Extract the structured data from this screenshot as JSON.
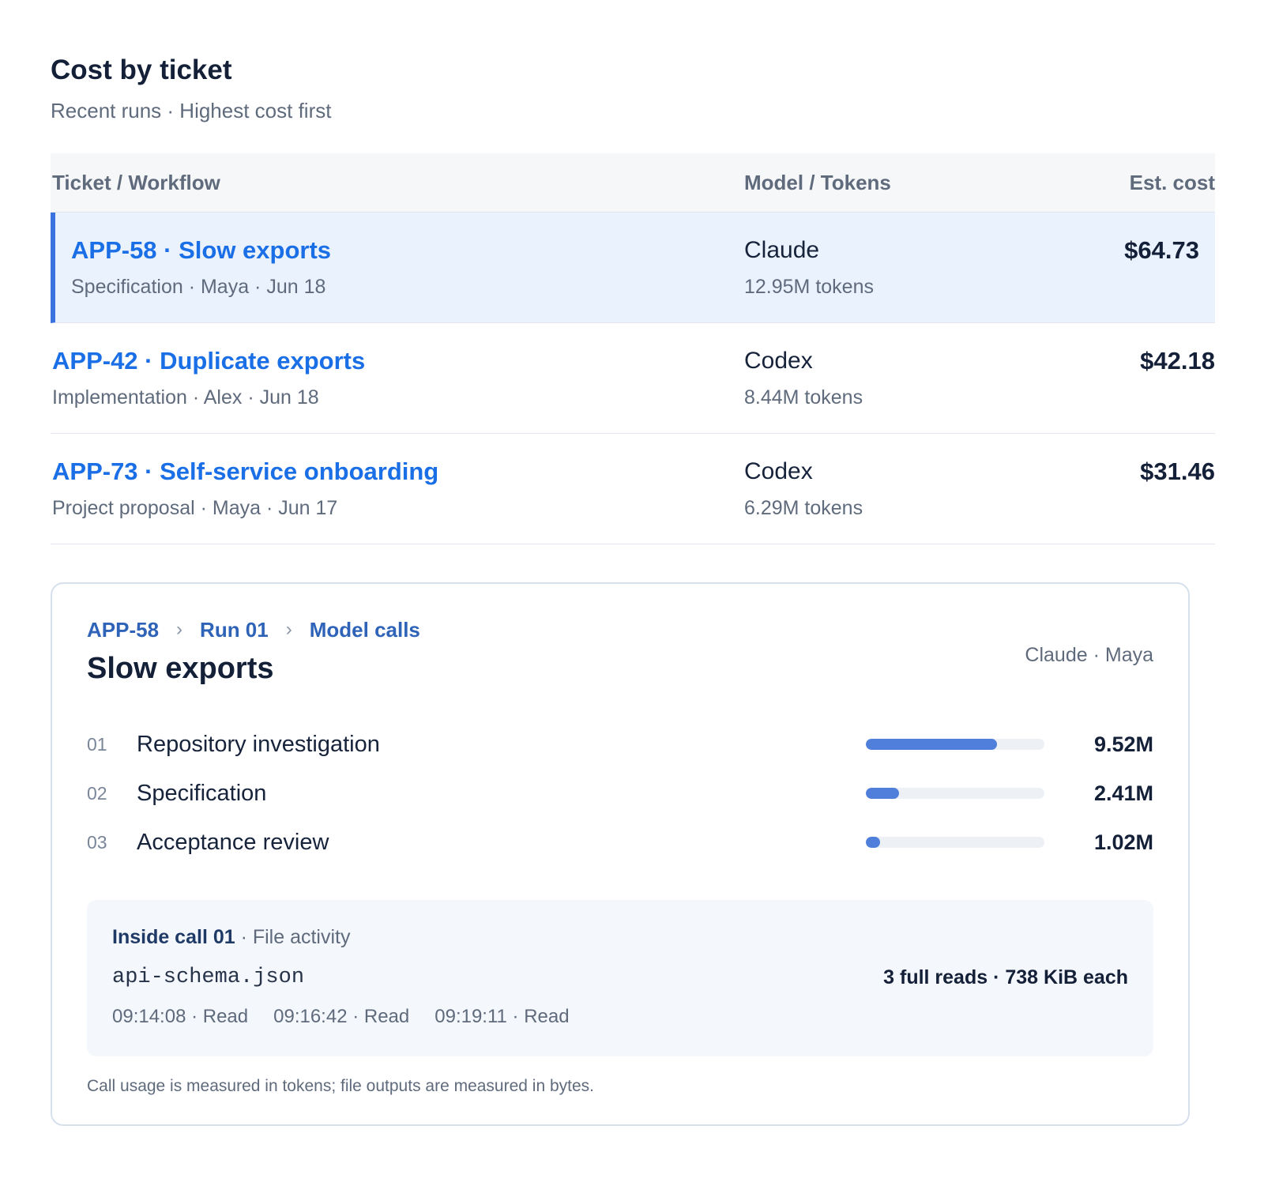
{
  "header": {
    "title": "Cost by ticket",
    "subtitle": "Recent runs · Highest cost first"
  },
  "table": {
    "columns": [
      "Ticket / Workflow",
      "Model / Tokens",
      "Est. cost"
    ],
    "rows": [
      {
        "ticket": "APP-58 · Slow exports",
        "meta": "Specification · Maya · Jun 18",
        "model": "Claude",
        "tokens": "12.95M tokens",
        "cost": "$64.73",
        "selected": true
      },
      {
        "ticket": "APP-42 · Duplicate exports",
        "meta": "Implementation · Alex · Jun 18",
        "model": "Codex",
        "tokens": "8.44M tokens",
        "cost": "$42.18",
        "selected": false
      },
      {
        "ticket": "APP-73 · Self-service onboarding",
        "meta": "Project proposal · Maya · Jun 17",
        "model": "Codex",
        "tokens": "6.29M tokens",
        "cost": "$31.46",
        "selected": false
      }
    ]
  },
  "detail": {
    "breadcrumb": [
      "APP-58",
      "Run 01",
      "Model calls"
    ],
    "breadcrumb_separator": "›",
    "title": "Slow exports",
    "meta": "Claude · Maya",
    "steps": [
      {
        "num": "01",
        "name": "Repository investigation",
        "value": "9.52M",
        "fraction": 0.735
      },
      {
        "num": "02",
        "name": "Specification",
        "value": "2.41M",
        "fraction": 0.186
      },
      {
        "num": "03",
        "name": "Acceptance review",
        "value": "1.02M",
        "fraction": 0.079
      }
    ],
    "file_activity": {
      "heading_strong": "Inside call 01",
      "heading_light": " · File activity",
      "file_name": "api-schema.json",
      "summary": "3 full reads · 738 KiB each",
      "reads": [
        "09:14:08 · Read",
        "09:16:42 · Read",
        "09:19:11 · Read"
      ]
    },
    "footnote": "Call usage is measured in tokens; file outputs are measured in bytes."
  },
  "colors": {
    "accent": "#1a6ee6",
    "selected_row_bg": "#eaf2fe",
    "selected_row_border": "#3a73e0",
    "bar_fill": "#4f7fdb",
    "bar_track": "#edf1f6"
  }
}
